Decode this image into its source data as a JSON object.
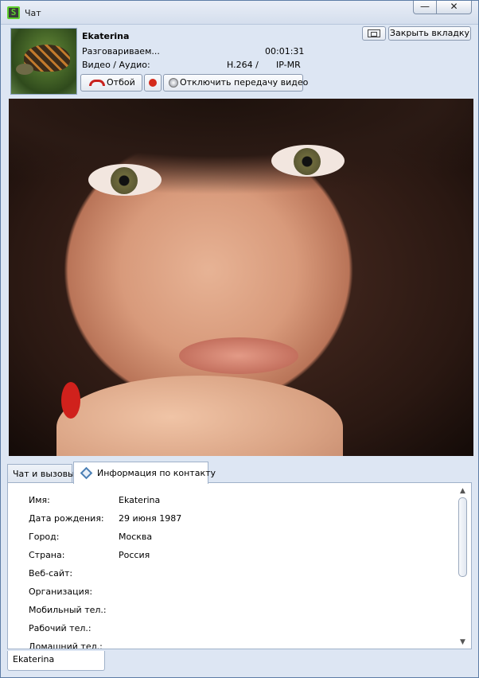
{
  "window": {
    "title": "Чат",
    "minimize": "—",
    "close": "✕",
    "app_icon_glyph": "S"
  },
  "call": {
    "contact_name": "Ekaterina",
    "status": "Разговариваем...",
    "duration": "00:01:31",
    "media_label": "Видео / Аудио:",
    "codec": "H.264 /",
    "protocol": "IP-MR",
    "hangup_label": "Отбой",
    "disable_video_label": "Отключить передачу  видео",
    "close_tab_label": "Закрыть вкладку"
  },
  "tabs": [
    {
      "label": "Чат и вызовы",
      "active": false
    },
    {
      "label": "Информация по контакту",
      "active": true
    }
  ],
  "contact_info": [
    {
      "label": "Имя:",
      "value": "Ekaterina"
    },
    {
      "label": "Дата рождения:",
      "value": "29 июня 1987"
    },
    {
      "label": "Город:",
      "value": "Москва"
    },
    {
      "label": "Страна:",
      "value": "Россия"
    },
    {
      "label": "Веб-сайт:",
      "value": ""
    },
    {
      "label": "Организация:",
      "value": ""
    },
    {
      "label": "Мобильный тел.:",
      "value": ""
    },
    {
      "label": "Рабочий тел.:",
      "value": ""
    },
    {
      "label": "Домашний тел.:",
      "value": ""
    }
  ],
  "bottom_tab": {
    "label": "Ekaterina"
  },
  "colors": {
    "accent": "#5fcf2e",
    "hangup": "#c8211d",
    "record": "#d42a1c",
    "window_bg": "#dde6f3"
  },
  "icons": [
    "app-logo-icon",
    "phone-hangup-icon",
    "record-icon",
    "webcam-icon",
    "popout-icon",
    "contact-info-icon"
  ]
}
